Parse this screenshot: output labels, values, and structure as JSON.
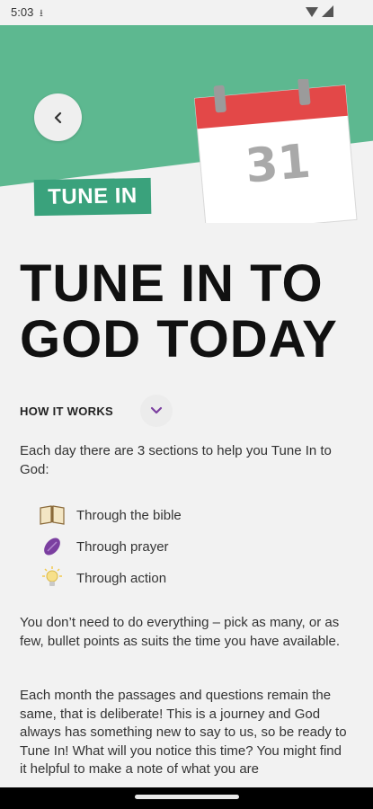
{
  "status": {
    "time": "5:03",
    "download_glyph": "⭳"
  },
  "header": {
    "back_icon": "chevron-left-icon",
    "calendar_day": "31",
    "tag_label": "TUNE IN"
  },
  "page": {
    "title": "TUNE IN TO GOD TODAY",
    "how_it_works_label": "HOW IT WORKS",
    "intro": "Each day there are 3 sections to help you Tune In to God:",
    "sections": [
      {
        "icon": "open-book-icon",
        "label": "Through the bible"
      },
      {
        "icon": "praying-hands-icon",
        "label": "Through prayer"
      },
      {
        "icon": "lightbulb-icon",
        "label": "Through action"
      }
    ],
    "para2": "You don’t need to do everything – pick as many, or as few, bullet points as suits the time you have available.",
    "para3": "Each month the passages and questions remain the same, that is deliberate! This is a journey and God always has something new to say to us, so be ready to Tune In! What will you notice this time? You might find it helpful to make a note of what you are"
  },
  "colors": {
    "hero_green": "#5db890",
    "tag_green": "#3aa27c",
    "calendar_red": "#e34848",
    "accent_purple": "#7b3fa0"
  }
}
